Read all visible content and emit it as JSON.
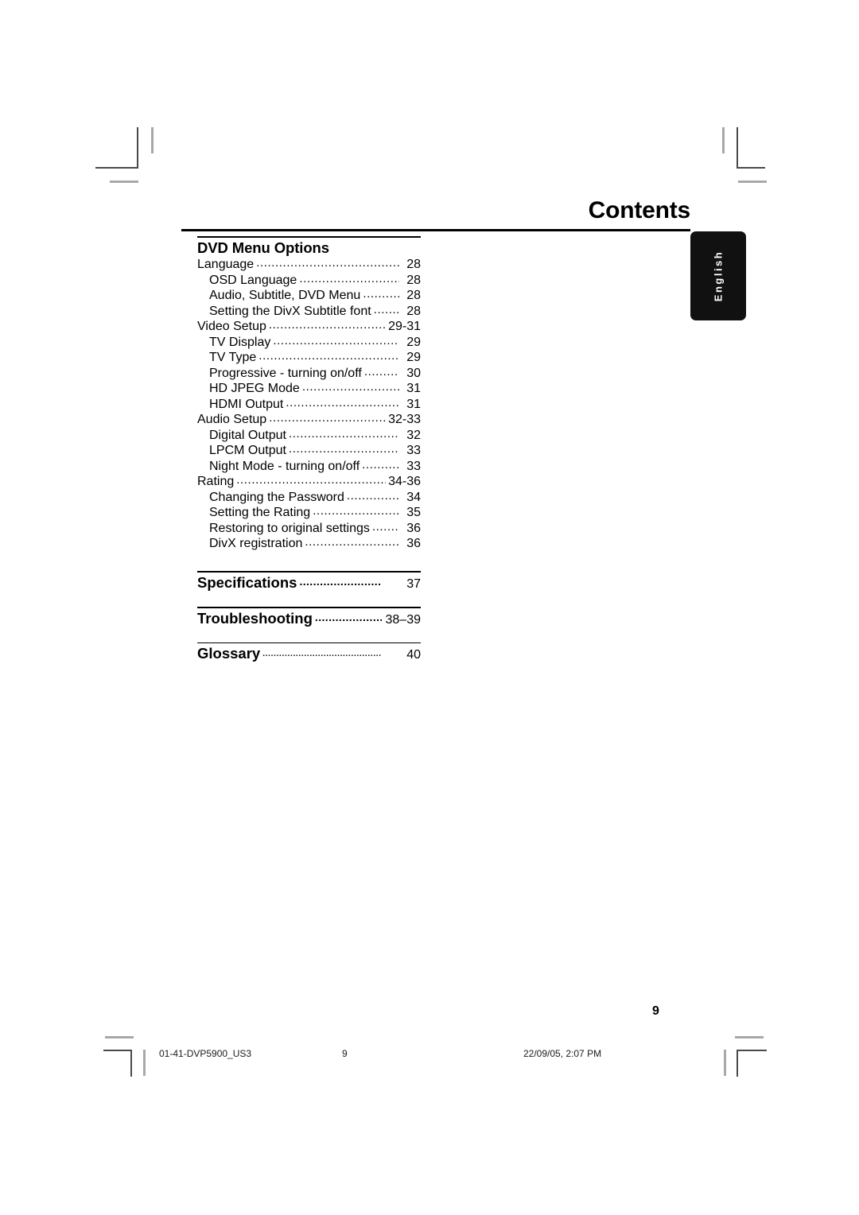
{
  "page": {
    "title": "Contents",
    "number": "9",
    "language_tab": "English"
  },
  "toc": {
    "sections": [
      {
        "heading": "DVD Menu Options",
        "entries": [
          {
            "label": "Language",
            "page": "28",
            "level": 1
          },
          {
            "label": "OSD Language",
            "page": "28",
            "level": 2
          },
          {
            "label": "Audio, Subtitle, DVD Menu",
            "page": "28",
            "level": 2
          },
          {
            "label": "Setting the DivX Subtitle font",
            "page": "28",
            "level": 2
          },
          {
            "label": "Video Setup",
            "page": "29-31",
            "level": 1
          },
          {
            "label": "TV Display",
            "page": "29",
            "level": 2
          },
          {
            "label": "TV Type",
            "page": "29",
            "level": 2
          },
          {
            "label": "Progressive - turning on/off",
            "page": "30",
            "level": 2
          },
          {
            "label": "HD JPEG Mode",
            "page": "31",
            "level": 2
          },
          {
            "label": "HDMI Output",
            "page": "31",
            "level": 2
          },
          {
            "label": "Audio Setup",
            "page": "32-33",
            "level": 1
          },
          {
            "label": "Digital Output",
            "page": "32",
            "level": 2
          },
          {
            "label": "LPCM Output",
            "page": "33",
            "level": 2
          },
          {
            "label": "Night Mode - turning on/off",
            "page": "33",
            "level": 2
          },
          {
            "label": "Rating",
            "page": "34-36",
            "level": 1
          },
          {
            "label": "Changing the Password",
            "page": "34",
            "level": 2
          },
          {
            "label": "Setting the Rating",
            "page": "35",
            "level": 2
          },
          {
            "label": "Restoring to original settings",
            "page": "36",
            "level": 2
          },
          {
            "label": "DivX registration",
            "page": "36",
            "level": 2
          }
        ]
      }
    ],
    "major_entries": [
      {
        "label": "Specifications",
        "page": "37"
      },
      {
        "label": "Troubleshooting",
        "page": "38–39"
      },
      {
        "label": "Glossary",
        "page": "40"
      }
    ]
  },
  "footer": {
    "filename": "01-41-DVP5900_US3",
    "page": "9",
    "date": "22/09/05, 2:07 PM"
  }
}
